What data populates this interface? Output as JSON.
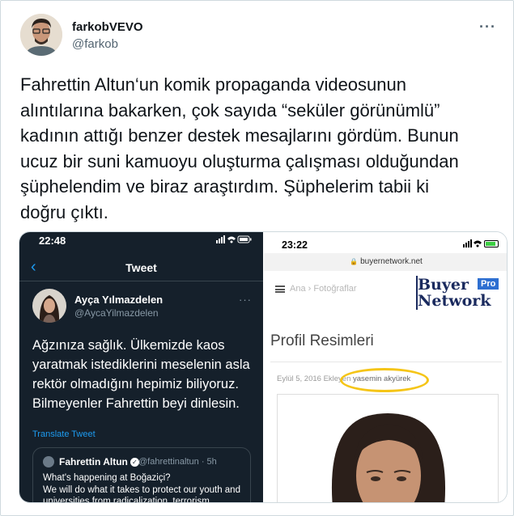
{
  "tweet": {
    "display_name": "farkobVEVO",
    "handle": "@farkob",
    "more_label": "···",
    "text": "Fahrettin Altun‘un komik propaganda videosunun\nalıntılarına bakarken, çok sayıda “seküler görünümlü”\nkadının attığı benzer destek mesajlarını gördüm. Bunun\nucuz bir suni kamuoyu oluşturma çalışması olduğundan\nşüphelendim ve biraz araştırdım. Şüphelerim tabii ki\ndoğru çıktı."
  },
  "left_screenshot": {
    "status_time": "22:48",
    "back_icon": "‹",
    "nav_title": "Tweet",
    "author_name": "Ayça Yılmazdelen",
    "author_handle": "@AycaYilmazdelen",
    "more_label": "···",
    "body": "Ağzınıza sağlık. Ülkemizde kaos yaratmak istediklerini meselenin asla rektör olmadığını hepimiz biliyoruz. Bilmeyenler Fahrettin beyi dinlesin.",
    "translate_label": "Translate Tweet",
    "quote": {
      "author_name": "Fahrettin Altun",
      "author_handle": "@fahrettinaltun · 5h",
      "text": "What's happening at Boğaziçi?\nWe will do what it takes to protect our youth and universities from radicalization, terrorism"
    }
  },
  "right_screenshot": {
    "status_time": "23:22",
    "url": "buyernetwork.net",
    "breadcrumb": "Ana › Fotoğraflar",
    "logo": {
      "buyer": "Buyer",
      "pro": "Pro",
      "network": "Network"
    },
    "page_heading": "Profil Resimleri",
    "meta_prefix": "Eylül 5, 2016 Ekleyen ",
    "meta_name": "yasemin akyürek",
    "colors": {
      "highlight": "#f5c518",
      "logo_blue": "#1a2a5e",
      "pro_badge": "#2e6fd1"
    }
  }
}
